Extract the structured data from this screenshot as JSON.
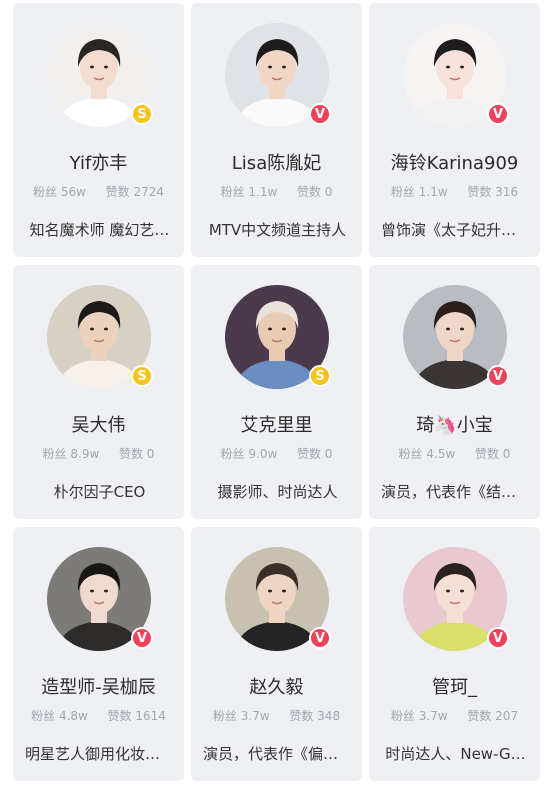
{
  "cards": [
    {
      "name": "Yif亦丰",
      "fans_label": "粉丝",
      "fans": "56w",
      "likes_label": "赞数",
      "likes": "2724",
      "bio": "知名魔术师 魔幻艺…",
      "badge": "s",
      "badge_icon": "super-star-badge-icon"
    },
    {
      "name": "Lisa陈胤妃",
      "fans_label": "粉丝",
      "fans": "1.1w",
      "likes_label": "赞数",
      "likes": "0",
      "bio": "MTV中文频道主持人",
      "badge": "v",
      "badge_icon": "verified-badge-icon"
    },
    {
      "name": "海铃Karina909",
      "fans_label": "粉丝",
      "fans": "1.1w",
      "likes_label": "赞数",
      "likes": "316",
      "bio": "曾饰演《太子妃升职…",
      "badge": "v",
      "badge_icon": "verified-badge-icon"
    },
    {
      "name": "吴大伟",
      "fans_label": "粉丝",
      "fans": "8.9w",
      "likes_label": "赞数",
      "likes": "0",
      "bio": "朴尔因子CEO",
      "badge": "s",
      "badge_icon": "super-star-badge-icon"
    },
    {
      "name": "艾克里里",
      "fans_label": "粉丝",
      "fans": "9.0w",
      "likes_label": "赞数",
      "likes": "0",
      "bio": "摄影师、时尚达人",
      "badge": "s",
      "badge_icon": "super-star-badge-icon"
    },
    {
      "name": "琦🦄小宝",
      "fans_label": "粉丝",
      "fans": "4.5w",
      "likes_label": "赞数",
      "likes": "0",
      "bio": "演员，代表作《结婚…",
      "badge": "v",
      "badge_icon": "verified-badge-icon"
    },
    {
      "name": "造型师-吴枷辰",
      "fans_label": "粉丝",
      "fans": "4.8w",
      "likes_label": "赞数",
      "likes": "1614",
      "bio": "明星艺人御用化妆师…",
      "badge": "v",
      "badge_icon": "verified-badge-icon"
    },
    {
      "name": "赵久毅",
      "fans_label": "粉丝",
      "fans": "3.7w",
      "likes_label": "赞数",
      "likes": "348",
      "bio": "演员，代表作《偏偏…",
      "badge": "v",
      "badge_icon": "verified-badge-icon"
    },
    {
      "name": "管珂_",
      "fans_label": "粉丝",
      "fans": "3.7w",
      "likes_label": "赞数",
      "likes": "207",
      "bio": "时尚达人、New-G…",
      "badge": "v",
      "badge_icon": "verified-badge-icon"
    }
  ],
  "badge_glyphs": {
    "v": "V",
    "s": "S"
  },
  "colors": {
    "card_bg": "#eef0f4",
    "verified": "#f0425a",
    "super_star": "#f8c21a",
    "name_text": "#2b2b2b",
    "stats_text": "#a2a6ae"
  },
  "avatar_palettes": [
    {
      "bg": "#f2f0ee",
      "hair": "#2a2624",
      "skin": "#f3ddd0",
      "cloth": "#ffffff"
    },
    {
      "bg": "#dfe2e7",
      "hair": "#1d1b1b",
      "skin": "#f1d6c6",
      "cloth": "#fafafa"
    },
    {
      "bg": "#f6f3f2",
      "hair": "#1e1c1c",
      "skin": "#f6e2d8",
      "cloth": "#f2f2f2"
    },
    {
      "bg": "#d7d0c4",
      "hair": "#1c1a19",
      "skin": "#ecd2bd",
      "cloth": "#f6f1ea"
    },
    {
      "bg": "#4a3a4c",
      "hair": "#e7e3dc",
      "skin": "#e9cbb3",
      "cloth": "#6a8ec0"
    },
    {
      "bg": "#b9bcc2",
      "hair": "#2a1f1c",
      "skin": "#f0d6c8",
      "cloth": "#3a3433"
    },
    {
      "bg": "#7c7b77",
      "hair": "#181716",
      "skin": "#f0dace",
      "cloth": "#2c2b29"
    },
    {
      "bg": "#c8c0b0",
      "hair": "#3a2e26",
      "skin": "#efd4c4",
      "cloth": "#242424"
    },
    {
      "bg": "#e9c8cf",
      "hair": "#2a2220",
      "skin": "#f6dfd4",
      "cloth": "#d9df6a"
    }
  ]
}
